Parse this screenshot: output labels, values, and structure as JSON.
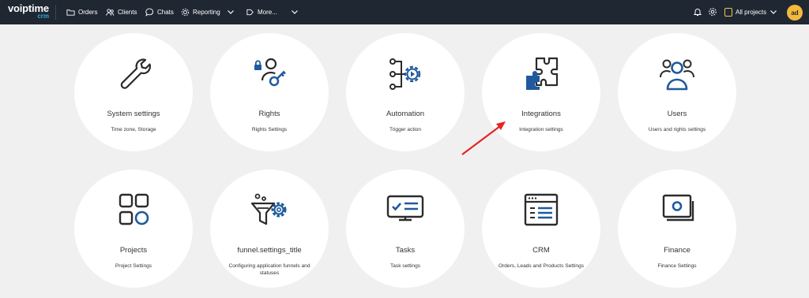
{
  "header": {
    "logo_main": "voiptime",
    "logo_sub": "crm",
    "nav": [
      {
        "label": "Orders",
        "icon": "folder-icon"
      },
      {
        "label": "Clients",
        "icon": "users-icon"
      },
      {
        "label": "Chats",
        "icon": "chat-icon"
      },
      {
        "label": "Reporting",
        "icon": "reporting-icon"
      },
      {
        "label": "More...",
        "icon": "more-icon"
      }
    ],
    "project_label": "All projects",
    "avatar_initials": "ad"
  },
  "cards": [
    {
      "title": "System settings",
      "subtitle": "Time zone, Storage",
      "icon": "wrench-icon"
    },
    {
      "title": "Rights",
      "subtitle": "Rights Settings",
      "icon": "rights-key-icon"
    },
    {
      "title": "Automation",
      "subtitle": "Trigger action",
      "icon": "automation-flow-icon"
    },
    {
      "title": "Integrations",
      "subtitle": "Integration settings",
      "icon": "puzzle-icon"
    },
    {
      "title": "Users",
      "subtitle": "Users and rights settings",
      "icon": "users-group-icon"
    },
    {
      "title": "Projects",
      "subtitle": "Project Settings",
      "icon": "projects-grid-icon"
    },
    {
      "title": "funnel.settings_title",
      "subtitle": "Configuring application funnels and statuses",
      "icon": "funnel-gear-icon"
    },
    {
      "title": "Tasks",
      "subtitle": "Task settings",
      "icon": "tasks-monitor-icon"
    },
    {
      "title": "CRM",
      "subtitle": "Orders, Leads and Products Settings",
      "icon": "crm-window-icon"
    },
    {
      "title": "Finance",
      "subtitle": "Finance Settings",
      "icon": "finance-icon"
    }
  ],
  "colors": {
    "topbar": "#1f2733",
    "icon_dark": "#2b2b2b",
    "icon_blue": "#1f5a9e",
    "annotation": "#e52521",
    "avatar": "#f4b93c"
  }
}
